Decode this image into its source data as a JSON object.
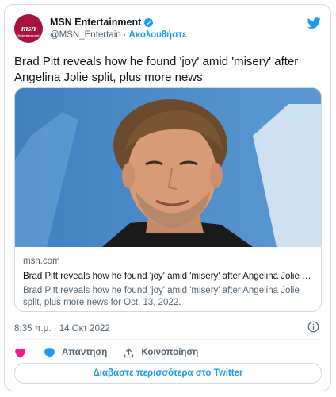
{
  "account": {
    "avatar_logo_text": "msn",
    "avatar_logo_subtext": "Entertainment",
    "display_name": "MSN Entertainment",
    "handle": "@MSN_Entertain",
    "separator": "·",
    "follow_label": "Ακολουθήστε"
  },
  "tweet": {
    "text": "Brad Pitt reveals how he found 'joy' amid 'misery' after Angelina Jolie split, plus more news"
  },
  "link_card": {
    "domain": "msn.com",
    "title": "Brad Pitt reveals how he found 'joy' amid 'misery' after Angelina Jolie split, plus more news",
    "description": "Brad Pitt reveals how he found 'joy' amid 'misery' after Angelina Jolie split, plus more news for Oct. 13, 2022."
  },
  "timestamp": "8:35 π.μ. · 14 Οκτ 2022",
  "actions": {
    "reply_label": "Απάντηση",
    "share_label": "Κοινοποίηση"
  },
  "read_more_label": "Διαβάστε περισσότερα στο Twitter",
  "colors": {
    "brand_blue": "#1d9bf0",
    "like_pink": "#f91880",
    "avatar_bg": "#a7123f"
  }
}
